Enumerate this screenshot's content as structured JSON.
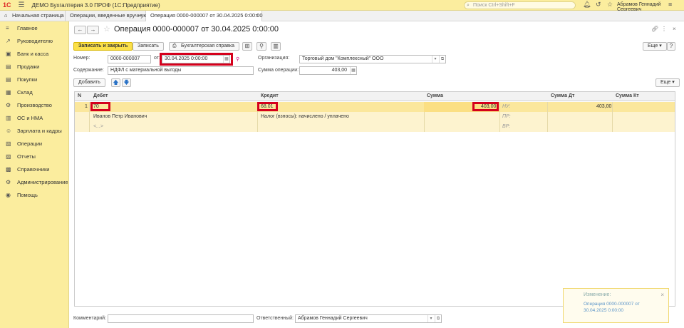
{
  "app": {
    "logo": "1С",
    "title": "ДЕМО Бухгалтерия 3.0 ПРОФ  (1С:Предприятие)",
    "search_placeholder": "Поиск Ctrl+Shift+F",
    "user": "Абрамов Геннадий Сергеевич"
  },
  "tabs": [
    {
      "label": "Начальная страница"
    },
    {
      "label": "Операции, введенные вручную"
    },
    {
      "label": "Операция 0000-000007 от 30.04.2025 0:00:00"
    }
  ],
  "sidebar": {
    "items": [
      {
        "label": "Главное",
        "icon": "≡"
      },
      {
        "label": "Руководителю",
        "icon": "↗"
      },
      {
        "label": "Банк и касса",
        "icon": "▣"
      },
      {
        "label": "Продажи",
        "icon": "▤"
      },
      {
        "label": "Покупки",
        "icon": "▤"
      },
      {
        "label": "Склад",
        "icon": "▦"
      },
      {
        "label": "Производство",
        "icon": "⚙"
      },
      {
        "label": "ОС и НМА",
        "icon": "▥"
      },
      {
        "label": "Зарплата и кадры",
        "icon": "☺"
      },
      {
        "label": "Операции",
        "icon": "▧"
      },
      {
        "label": "Отчеты",
        "icon": "▨"
      },
      {
        "label": "Справочники",
        "icon": "▩"
      },
      {
        "label": "Администрирование",
        "icon": "⚙"
      },
      {
        "label": "Помощь",
        "icon": "◉"
      }
    ]
  },
  "form": {
    "title": "Операция 0000-000007 от 30.04.2025 0:00:00",
    "btn_save_close": "Записать и закрыть",
    "btn_save": "Записать",
    "btn_report": "Бухгалтерская справка",
    "btn_more": "Еще",
    "btn_help": "?",
    "number_label": "Номер:",
    "number_value": "0000-000007",
    "date_label": "от:",
    "date_value": "30.04.2025  0:00:00",
    "org_label": "Организация:",
    "org_value": "Торговый дом \"Комплексный\" ООО",
    "content_label": "Содержание:",
    "content_value": "НДФЛ с материальной выгоды",
    "sum_label": "Сумма операции:",
    "sum_value": "403,00",
    "btn_add": "Добавить",
    "comment_label": "Комментарий:",
    "comment_value": "",
    "responsible_label": "Ответственный:",
    "responsible_value": "Абрамов Геннадий Сергеевич"
  },
  "table": {
    "headers": {
      "n": "N",
      "debit": "Дебет",
      "credit": "Кредит",
      "sum": "Сумма",
      "sum_dt": "Сумма Дт",
      "sum_kt": "Сумма Кт"
    },
    "row": {
      "n": "1",
      "debit_account": "70",
      "debit_subconto1": "Иванов Петр Иванович",
      "debit_subconto2": "<...>",
      "credit_account": "68.01",
      "credit_subconto1": "Налог (взносы): начислено / уплачено",
      "sum": "403,00",
      "nu_label": "НУ:",
      "pr_label": "ПР:",
      "vr_label": "ВР:",
      "sum_dt": "403,00"
    }
  },
  "notification": {
    "title": "Изменение:",
    "body": "Операция 0000-000007 от 30.04.2025 0:00:00"
  },
  "colors": {
    "accent_yellow": "#fbed9e",
    "primary_button": "#fbe04a",
    "highlight_red": "#d5001c",
    "row_selected": "#fbe79c"
  }
}
